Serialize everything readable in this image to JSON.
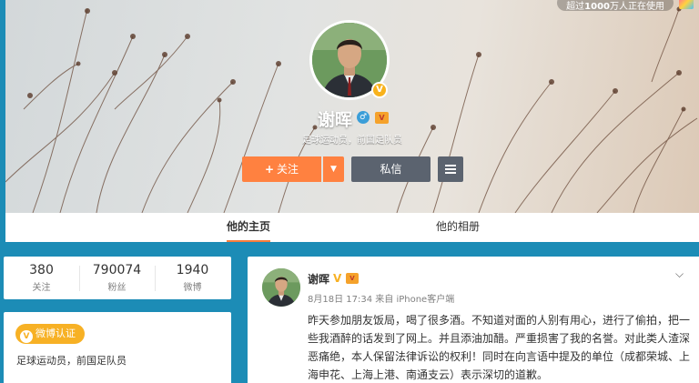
{
  "topbar": {
    "text_prefix": "超过",
    "text_strong": "1000",
    "text_suffix": "万人正在使用"
  },
  "profile": {
    "name": "谢晖",
    "description": "足球运动员，前国足队员",
    "buttons": {
      "follow": "关注",
      "message": "私信"
    }
  },
  "tabs": [
    {
      "label": "他的主页"
    },
    {
      "label": "他的相册"
    }
  ],
  "stats": [
    {
      "value": "380",
      "label": "关注"
    },
    {
      "value": "790074",
      "label": "粉丝"
    },
    {
      "value": "1940",
      "label": "微博"
    }
  ],
  "info": {
    "tag": "微博认证",
    "text": "足球运动员，前国足队员"
  },
  "post": {
    "author": "谢晖",
    "meta": "8月18日 17:34 来自 iPhone客户端",
    "lines": [
      "昨天参加朋友饭局，喝了很多酒。不知道对面的人别有用心，进行了偷拍，把一",
      "些我酒醉的话发到了网上。并且添油加醋。严重损害了我的名誉。对此类人渣深",
      "恶痛绝，本人保留法律诉讼的权利！同时在向言语中提及的单位（成都荣城、上",
      "海申花、上海上港、南通支云）表示深切的道歉。"
    ]
  },
  "colors": {
    "accent": "#ff8140",
    "verify": "#f7b125",
    "background": "#1c8cb6",
    "dark_button": "#5b636f"
  }
}
